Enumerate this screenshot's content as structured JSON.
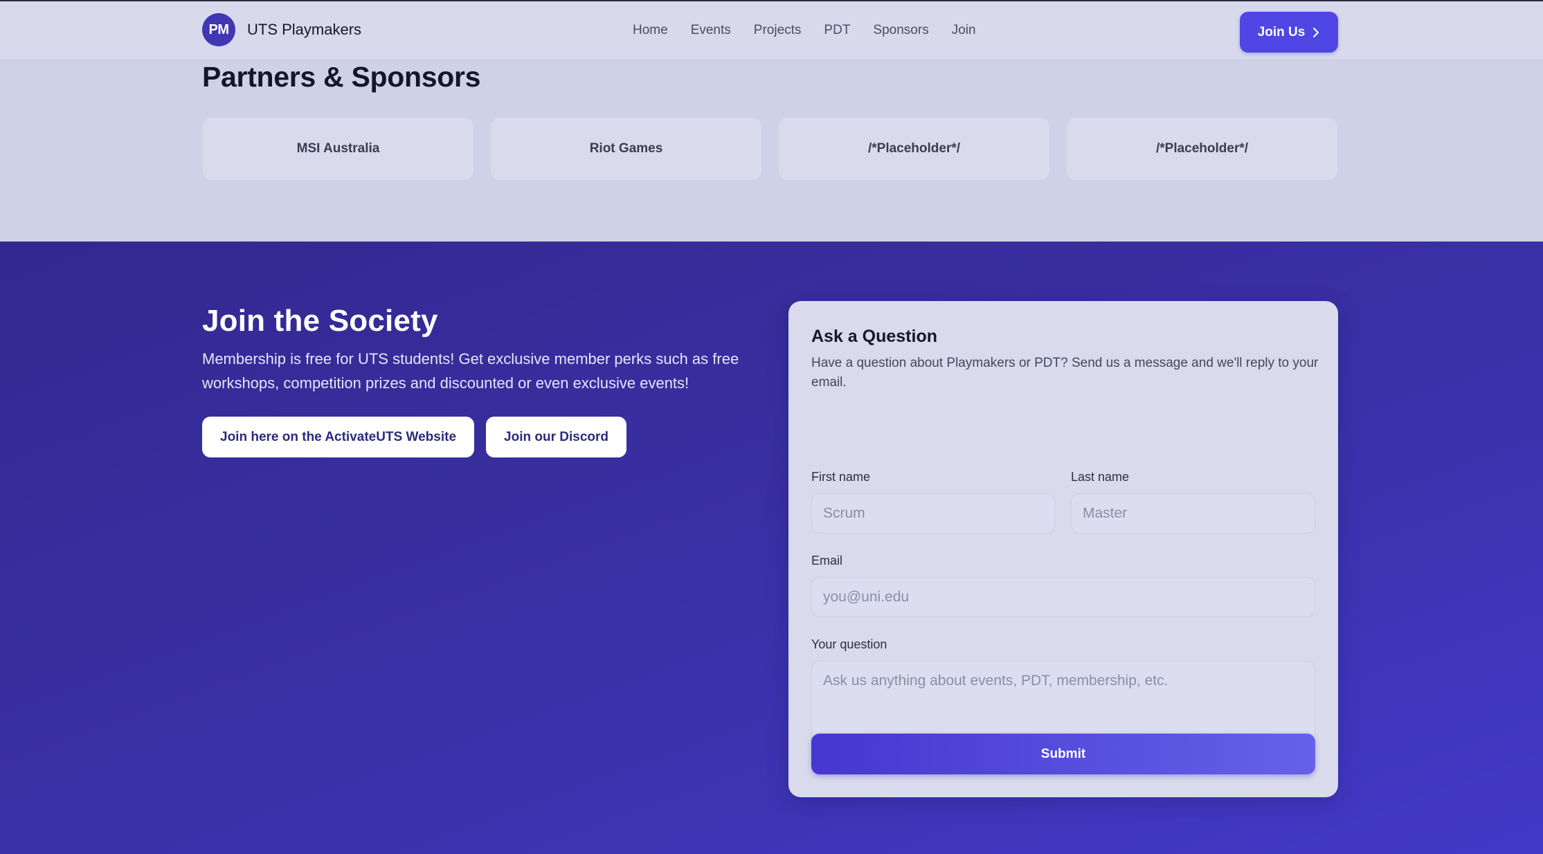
{
  "header": {
    "logo_text": "PM",
    "brand_name": "UTS Playmakers",
    "nav": [
      "Home",
      "Events",
      "Projects",
      "PDT",
      "Sponsors",
      "Join"
    ],
    "cta_label": "Join Us"
  },
  "partners": {
    "title": "Partners & Sponsors",
    "items": [
      "MSI Australia",
      "Riot Games",
      "/*Placeholder*/",
      "/*Placeholder*/"
    ]
  },
  "join": {
    "title": "Join the Society",
    "description": "Membership is free for UTS students! Get exclusive member perks such as free workshops, competition prizes and discounted or even exclusive events!",
    "buttons": [
      "Join here on the ActivateUTS Website",
      "Join our Discord"
    ]
  },
  "form": {
    "title": "Ask a Question",
    "description": "Have a question about Playmakers or PDT? Send us a message and we'll reply to your email.",
    "first_name_label": "First name",
    "first_name_placeholder": "Scrum",
    "last_name_label": "Last name",
    "last_name_placeholder": "Master",
    "email_label": "Email",
    "email_placeholder": "you@uni.edu",
    "question_label": "Your question",
    "question_placeholder": "Ask us anything about events, PDT, membership, etc.",
    "submit_label": "Submit"
  },
  "colors": {
    "accent": "#4f46e5",
    "header_bg": "#d8daeb",
    "page_bg": "#cfd1e6",
    "join_section_bg": "#3a31a8",
    "card_bg": "#d9dbec"
  },
  "icons": {
    "cta": "chevron-right-icon"
  }
}
